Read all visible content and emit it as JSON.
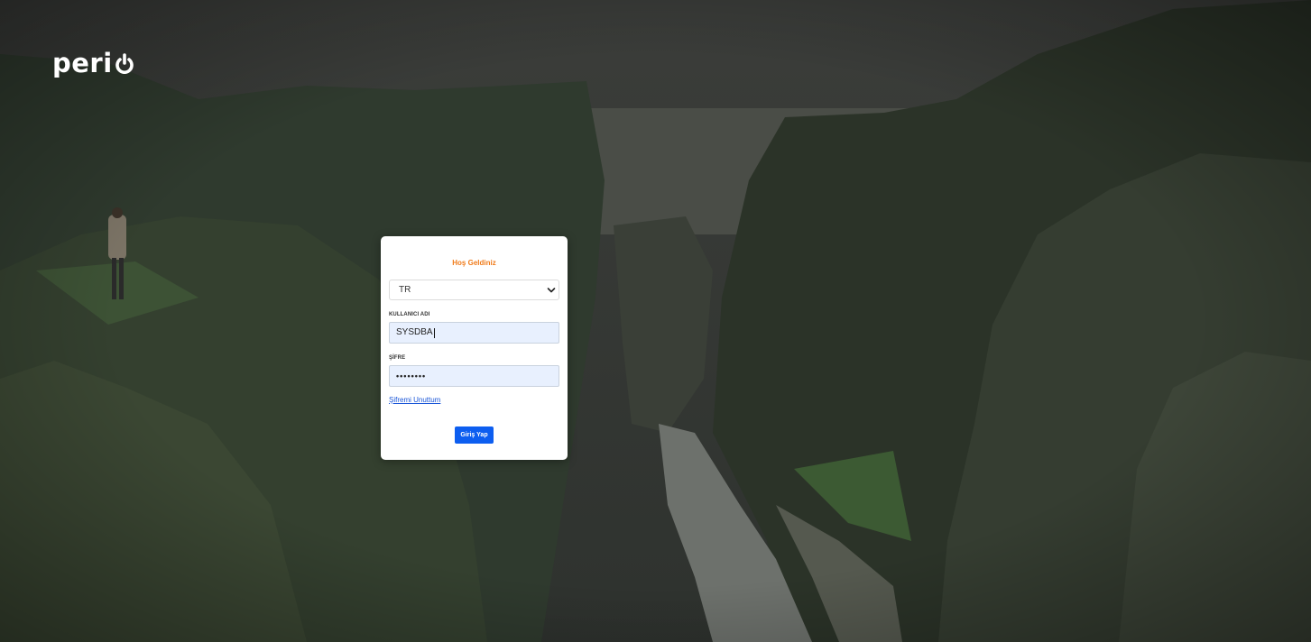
{
  "brand": {
    "logo_text": "peri"
  },
  "login": {
    "title": "Hoş Geldiniz",
    "language": {
      "selected": "TR"
    },
    "username": {
      "label": "KULLANICI ADI",
      "value": "SYSDBA"
    },
    "password": {
      "label": "ŞİFRE",
      "masked_value": "••••••••"
    },
    "forgot_link": "Şifremi Unuttum",
    "submit_label": "Giriş Yap"
  },
  "colors": {
    "accent": "#f07b1a",
    "button": "#0d5ef0",
    "link": "#1a56d8",
    "input_bg": "#e8f0fe"
  }
}
